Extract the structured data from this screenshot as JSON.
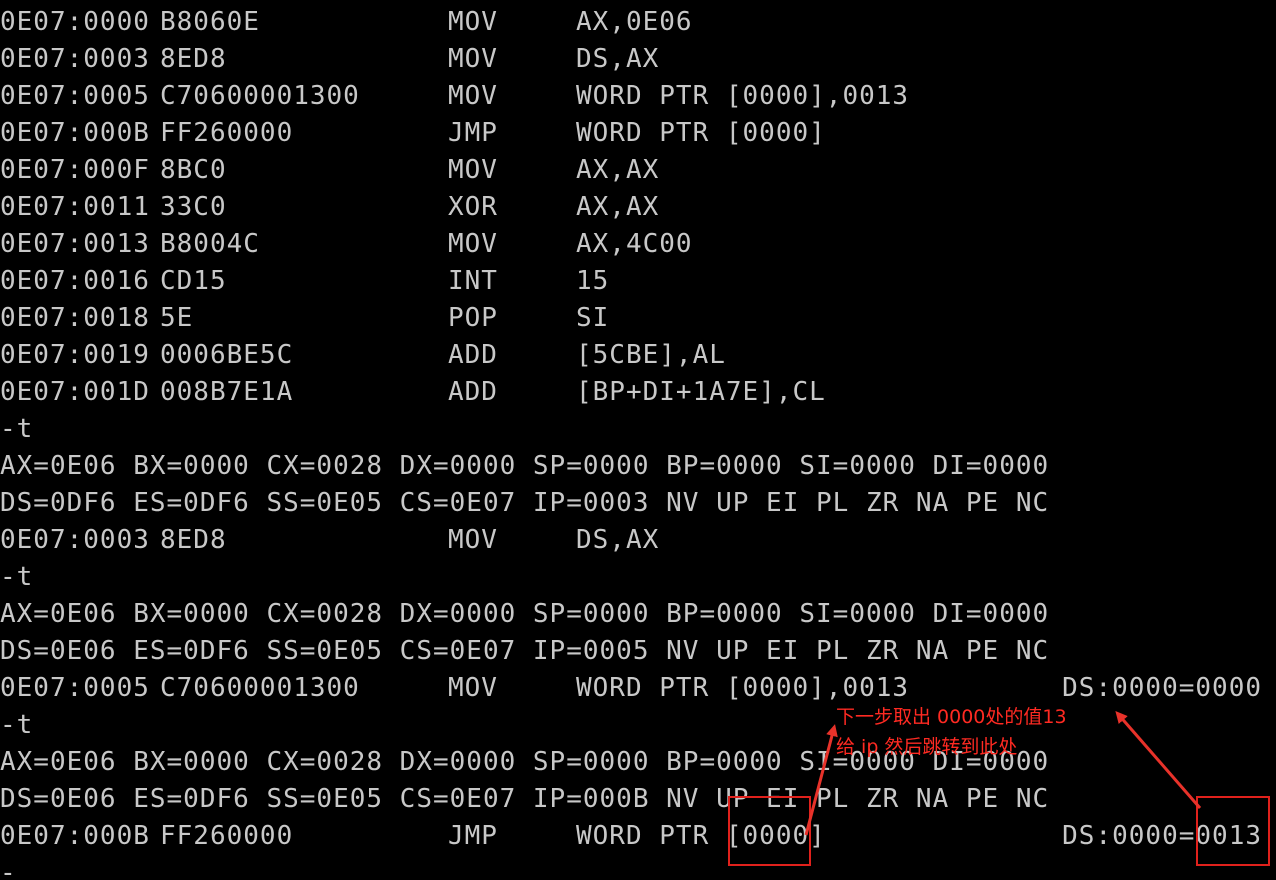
{
  "terminal": {
    "lines": [
      {
        "addr": "0E07:0000",
        "bytes": "B8060E",
        "mnem": "MOV",
        "ops": "AX,0E06"
      },
      {
        "addr": "0E07:0003",
        "bytes": "8ED8",
        "mnem": "MOV",
        "ops": "DS,AX"
      },
      {
        "addr": "0E07:0005",
        "bytes": "C70600001300",
        "mnem": "MOV",
        "ops": "WORD PTR [0000],0013"
      },
      {
        "addr": "0E07:000B",
        "bytes": "FF260000",
        "mnem": "JMP",
        "ops": "WORD PTR [0000]"
      },
      {
        "addr": "0E07:000F",
        "bytes": "8BC0",
        "mnem": "MOV",
        "ops": "AX,AX"
      },
      {
        "addr": "0E07:0011",
        "bytes": "33C0",
        "mnem": "XOR",
        "ops": "AX,AX"
      },
      {
        "addr": "0E07:0013",
        "bytes": "B8004C",
        "mnem": "MOV",
        "ops": "AX,4C00"
      },
      {
        "addr": "0E07:0016",
        "bytes": "CD15",
        "mnem": "INT",
        "ops": "15"
      },
      {
        "addr": "0E07:0018",
        "bytes": "5E",
        "mnem": "POP",
        "ops": "SI"
      },
      {
        "addr": "0E07:0019",
        "bytes": "0006BE5C",
        "mnem": "ADD",
        "ops": "[5CBE],AL"
      },
      {
        "addr": "0E07:001D",
        "bytes": "008B7E1A",
        "mnem": "ADD",
        "ops": "[BP+DI+1A7E],CL"
      },
      {
        "text": "-t"
      },
      {
        "text": "AX=0E06 BX=0000 CX=0028 DX=0000 SP=0000 BP=0000 SI=0000 DI=0000"
      },
      {
        "text": "DS=0DF6 ES=0DF6 SS=0E05 CS=0E07 IP=0003 NV UP EI PL ZR NA PE NC"
      },
      {
        "addr": "0E07:0003",
        "bytes": "8ED8",
        "mnem": "MOV",
        "ops": "DS,AX"
      },
      {
        "text": "-t"
      },
      {
        "text": "AX=0E06 BX=0000 CX=0028 DX=0000 SP=0000 BP=0000 SI=0000 DI=0000"
      },
      {
        "text": "DS=0E06 ES=0DF6 SS=0E05 CS=0E07 IP=0005 NV UP EI PL ZR NA PE NC"
      },
      {
        "addr": "0E07:0005",
        "bytes": "C70600001300",
        "mnem": "MOV",
        "ops": "WORD PTR [0000],0013",
        "mem": "DS:0000=0000"
      },
      {
        "text": "-t"
      },
      {
        "text": "AX=0E06 BX=0000 CX=0028 DX=0000 SP=0000 BP=0000 SI=0000 DI=0000"
      },
      {
        "text": "DS=0E06 ES=0DF6 SS=0E05 CS=0E07 IP=000B NV UP EI PL ZR NA PE NC"
      },
      {
        "addr": "0E07:000B",
        "bytes": "FF260000",
        "mnem": "JMP",
        "ops": "WORD PTR [0000]",
        "mem": "DS:0000=0013"
      },
      {
        "text": "-"
      }
    ]
  },
  "annotation": {
    "line1": "下一步取出 0000处的值13",
    "line2": "给 ip 然后跳转到此处"
  },
  "colors": {
    "background": "#000000",
    "text": "#c8c8c8",
    "annotation": "#ff2a22"
  }
}
